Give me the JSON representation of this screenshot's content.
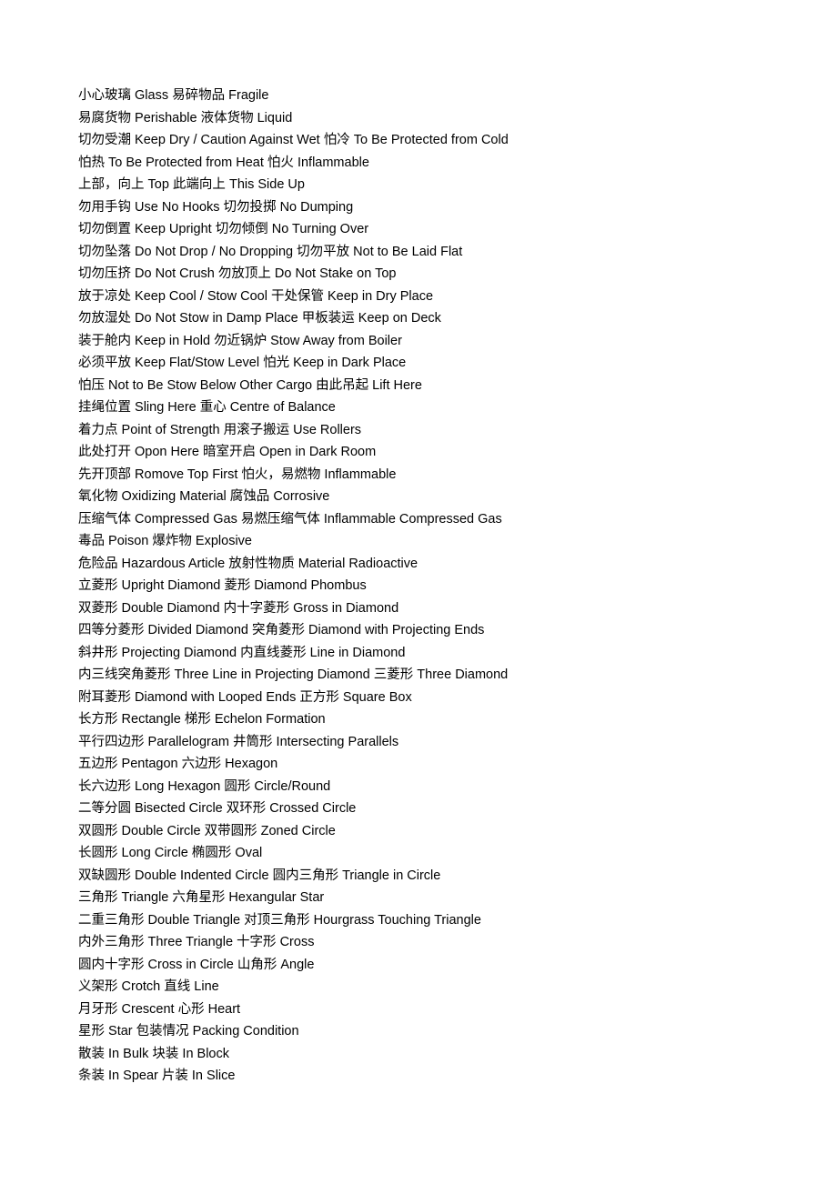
{
  "document": {
    "background_color": "#ffffff",
    "text_color": "#000000",
    "lines": [
      {
        "text": "小心玻璃  Glass  易碎物品  Fragile"
      },
      {
        "text": "易腐货物  Perishable  液体货物  Liquid"
      },
      {
        "text": "切勿受潮  Keep Dry / Caution Against Wet  怕冷  To Be Protected from Cold"
      },
      {
        "text": "怕热  To Be Protected from Heat  怕火  Inflammable"
      },
      {
        "text": "上部，向上  Top  此端向上  This Side Up"
      },
      {
        "text": "勿用手钩  Use No Hooks  切勿投掷  No Dumping"
      },
      {
        "text": "切勿倒置  Keep Upright  切勿倾倒  No Turning Over"
      },
      {
        "text": "切勿坠落 Do Not Drop / No Dropping  切勿平放  Not to Be Laid Flat"
      },
      {
        "text": "切勿压挤  Do Not Crush  勿放顶上  Do Not Stake on Top"
      },
      {
        "text": "放于凉处 Keep Cool / Stow Cool  干处保管 Keep in Dry Place"
      },
      {
        "text": "勿放湿处  Do Not Stow in Damp Place  甲板装运  Keep on Deck"
      },
      {
        "text": "装于舱内  Keep in Hold  勿近锅炉  Stow Away from Boiler"
      },
      {
        "text": "必须平放  Keep Flat/Stow Level  怕光  Keep in Dark Place"
      },
      {
        "text": "怕压  Not to Be Stow Below Other Cargo  由此吊起  Lift Here"
      },
      {
        "text": "挂绳位置  Sling Here  重心  Centre of Balance"
      },
      {
        "text": "着力点 Point of Strength  用滚子搬运  Use Rollers"
      },
      {
        "text": "此处打开  Opon Here  暗室开启  Open in Dark Room"
      },
      {
        "text": "先开顶部  Romove Top First  怕火，易燃物  Inflammable"
      },
      {
        "text": "氧化物  Oxidizing Material  腐蚀品  Corrosive"
      },
      {
        "text": "压缩气体 Compressed Gas  易燃压缩气体 Inflammable Compressed Gas"
      },
      {
        "text": "毒品  Poison  爆炸物  Explosive"
      },
      {
        "text": "危险品  Hazardous Article  放射性物质 Material Radioactive"
      },
      {
        "text": "立菱形  Upright Diamond  菱形  Diamond Phombus"
      },
      {
        "text": "双菱形  Double Diamond  内十字菱形  Gross in Diamond"
      },
      {
        "text": "四等分菱形  Divided Diamond  突角菱形 Diamond with Projecting Ends"
      },
      {
        "text": "斜井形  Projecting Diamond  内直线菱形  Line in Diamond"
      },
      {
        "text": "内三线突角菱形  Three Line in Projecting Diamond  三菱形  Three Diamond"
      },
      {
        "text": "附耳菱形  Diamond with Looped Ends  正方形  Square Box"
      },
      {
        "text": "长方形  Rectangle  梯形  Echelon Formation"
      },
      {
        "text": "平行四边形  Parallelogram  井筒形  Intersecting Parallels"
      },
      {
        "text": "五边形  Pentagon  六边形  Hexagon"
      },
      {
        "text": "长六边形  Long Hexagon  圆形  Circle/Round"
      },
      {
        "text": "二等分圆  Bisected Circle  双环形  Crossed Circle"
      },
      {
        "text": "双圆形  Double Circle  双带圆形  Zoned Circle"
      },
      {
        "text": "长圆形  Long Circle  椭圆形  Oval"
      },
      {
        "text": "双缺圆形  Double Indented Circle  圆内三角形  Triangle in Circle"
      },
      {
        "text": "三角形  Triangle  六角星形  Hexangular Star"
      },
      {
        "text": "二重三角形  Double Triangle  对顶三角形  Hourgrass Touching Triangle"
      },
      {
        "text": "内外三角形  Three Triangle  十字形  Cross"
      },
      {
        "text": "圆内十字形  Cross in Circle  山角形  Angle"
      },
      {
        "text": "义架形  Crotch  直线  Line"
      },
      {
        "text": "月牙形  Crescent  心形  Heart"
      },
      {
        "text": "星形  Star  包装情况  Packing Condition"
      },
      {
        "text": "散装  In Bulk  块装  In Block"
      },
      {
        "text": "条装  In Spear  片装  In Slice"
      }
    ]
  }
}
